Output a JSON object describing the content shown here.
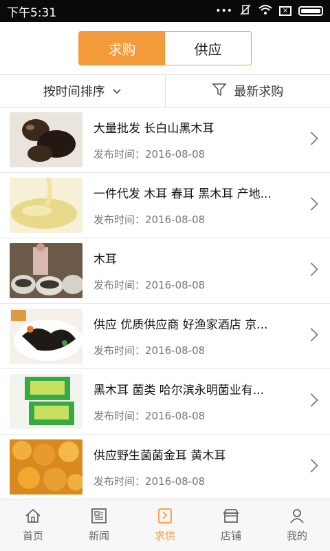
{
  "status": {
    "time": "下午5:31",
    "dots": "•••"
  },
  "segment": {
    "active": "求购",
    "inactive": "供应"
  },
  "filter": {
    "sort": "按时间排序",
    "latest": "最新求购"
  },
  "items": [
    {
      "title": "大量批发 长白山黑木耳",
      "date": "发布时间：2016-08-08"
    },
    {
      "title": "一件代发 木耳 春耳 黑木耳 产地...",
      "date": "发布时间：2016-08-08"
    },
    {
      "title": "木耳",
      "date": "发布时间：2016-08-08"
    },
    {
      "title": "供应  优质供应商  好渔家酒店 京...",
      "date": "发布时间：2016-08-08"
    },
    {
      "title": "黑木耳 菌类 哈尔滨永明菌业有...",
      "date": "发布时间：2016-08-08"
    },
    {
      "title": "供应野生菌菌金耳 黄木耳",
      "date": "发布时间：2016-08-08"
    }
  ],
  "tabs": [
    {
      "label": "首页",
      "icon": "home-icon"
    },
    {
      "label": "新闻",
      "icon": "news-icon"
    },
    {
      "label": "求供",
      "icon": "supply-icon"
    },
    {
      "label": "店铺",
      "icon": "store-icon"
    },
    {
      "label": "我的",
      "icon": "profile-icon"
    }
  ],
  "colors": {
    "accent": "#f39a3b",
    "statusbar": "#0a0a0a"
  }
}
